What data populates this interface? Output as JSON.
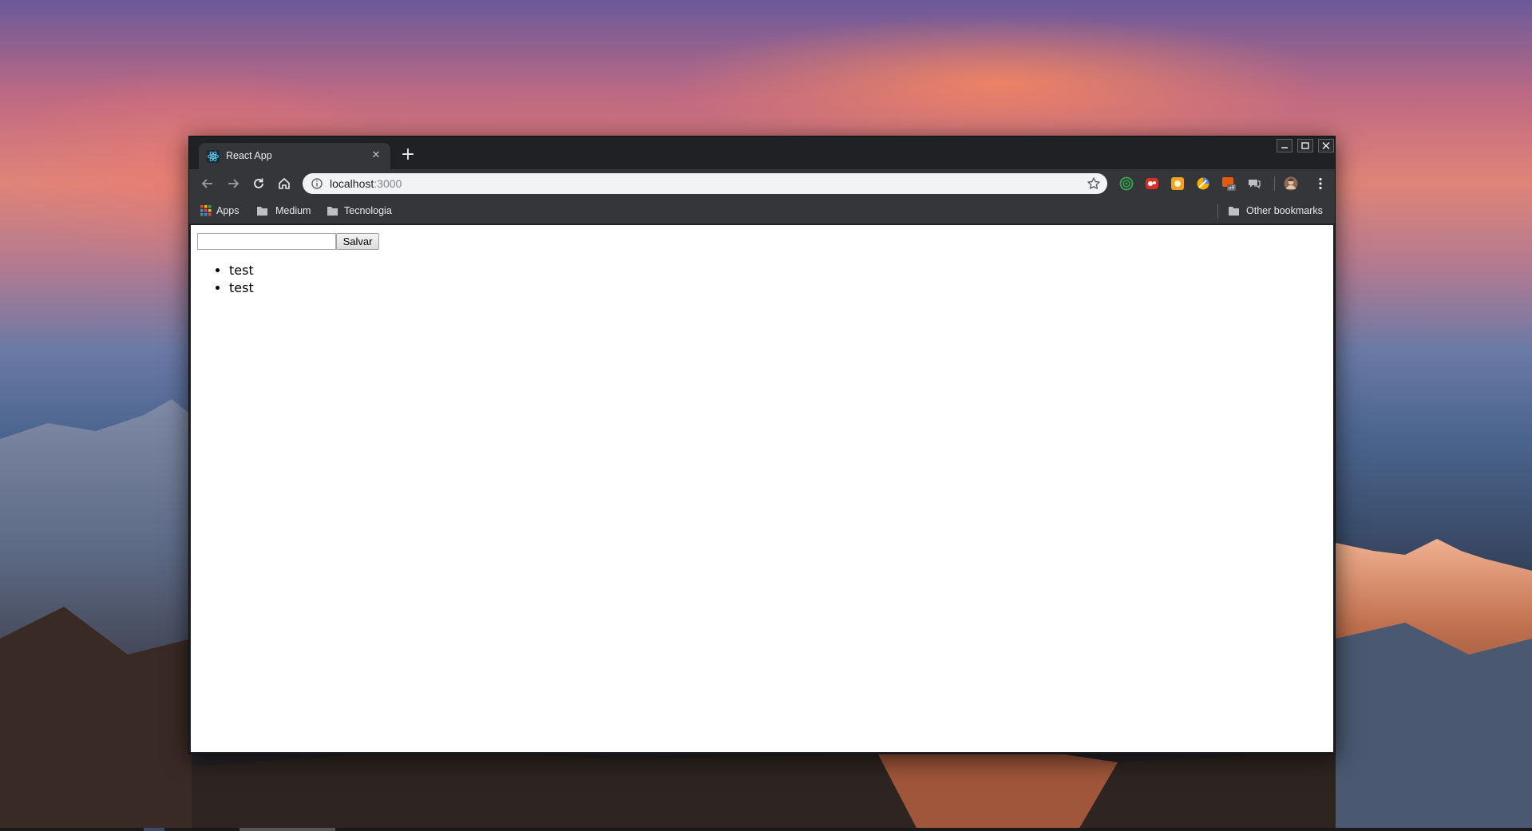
{
  "browser": {
    "tab": {
      "title": "React App",
      "favicon": "react-logo-icon"
    },
    "address_bar": {
      "host": "localhost",
      "port": ":3000"
    },
    "bookmarks": [
      {
        "label": "Apps",
        "icon": "apps-grid-icon"
      },
      {
        "label": "Medium",
        "icon": "folder-icon"
      },
      {
        "label": "Tecnologia",
        "icon": "folder-icon"
      }
    ],
    "other_bookmarks": {
      "label": "Other bookmarks",
      "icon": "folder-icon"
    },
    "extensions": [
      "green-target-extension-icon",
      "red-extension-icon",
      "orange-extension-icon",
      "color-picker-extension-icon",
      "off-badge-extension-icon",
      "chat-extension-icon"
    ],
    "extension_badge": "off"
  },
  "page": {
    "input": {
      "value": "",
      "placeholder": ""
    },
    "save_button_label": "Salvar",
    "items": [
      "test",
      "test"
    ]
  },
  "colors": {
    "tab_active": "#35363a",
    "frame": "#202124",
    "content": "#ffffff"
  }
}
